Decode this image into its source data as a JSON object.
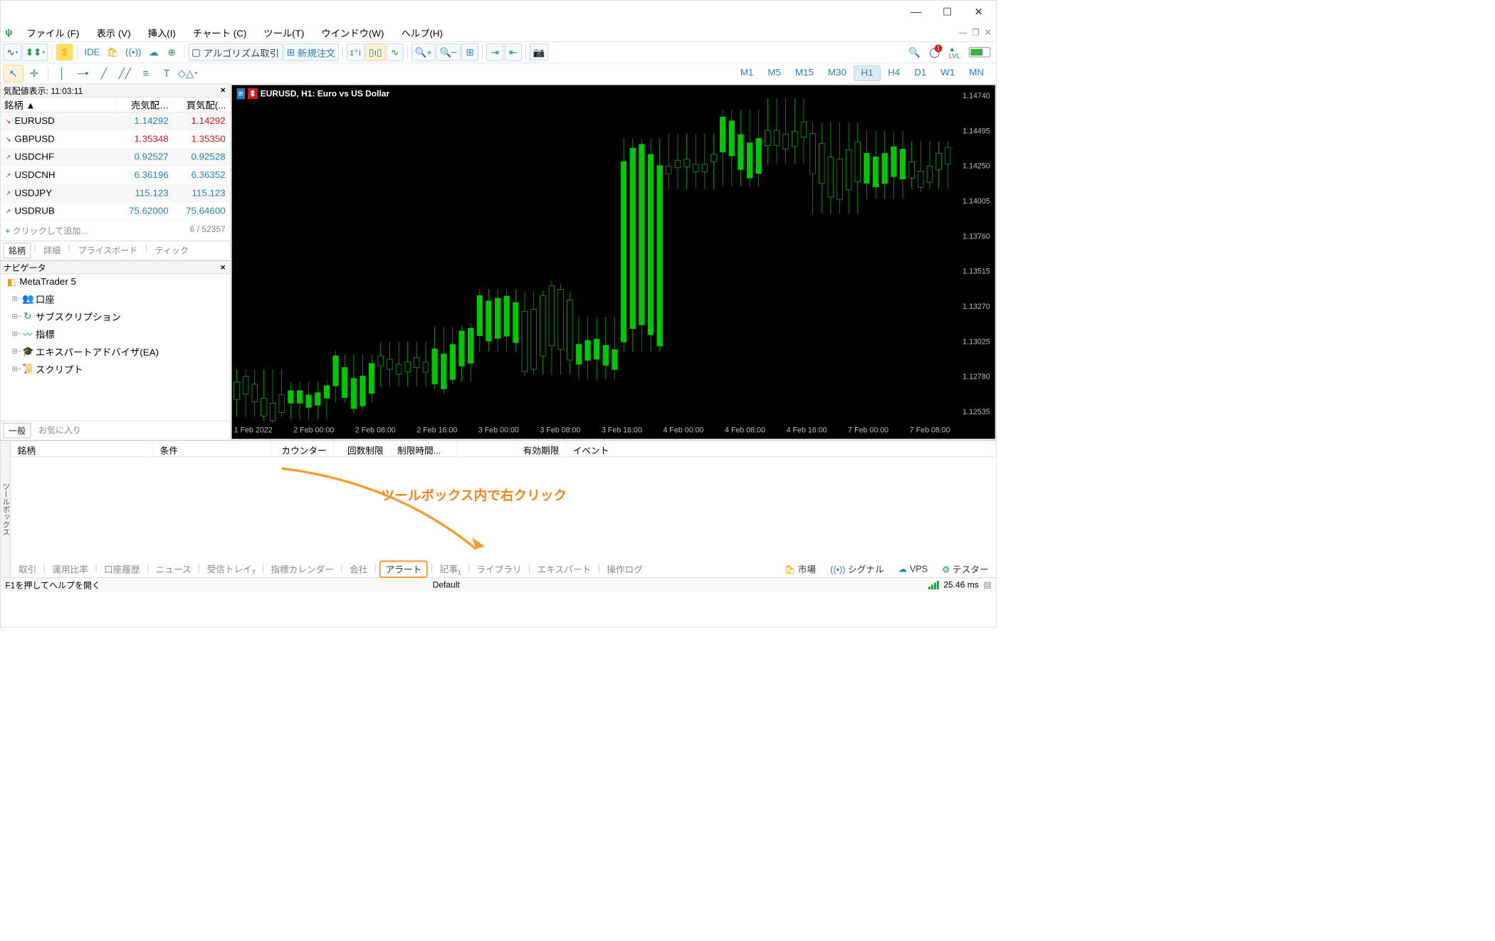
{
  "window": {
    "minimize": "—",
    "maximize": "☐",
    "close": "✕"
  },
  "menubar": {
    "logo": "ψ",
    "items": [
      "ファイル (F)",
      "表示 (V)",
      "挿入(I)",
      "チャート (C)",
      "ツール(T)",
      "ウインドウ(W)",
      "ヘルプ(H)"
    ]
  },
  "toolbar": {
    "algo": "アルゴリズム取引",
    "neworder": "新規注文",
    "notif_count": "1",
    "vps_label": "VPS"
  },
  "timeframes": [
    "M1",
    "M5",
    "M15",
    "M30",
    "H1",
    "H4",
    "D1",
    "W1",
    "MN"
  ],
  "timeframe_active": "H1",
  "market_watch": {
    "title": "気配値表示: 11:03:11",
    "cols": {
      "symbol": "銘柄  ▲",
      "bid": "売気配…",
      "ask": "買気配(..."
    },
    "rows": [
      {
        "dir": "down",
        "symbol": "EURUSD",
        "bid": "1.14292",
        "ask": "1.14292",
        "bidc": "blue",
        "askc": "red"
      },
      {
        "dir": "down",
        "symbol": "GBPUSD",
        "bid": "1.35348",
        "ask": "1.35350",
        "bidc": "red",
        "askc": "red"
      },
      {
        "dir": "up",
        "symbol": "USDCHF",
        "bid": "0.92527",
        "ask": "0.92528",
        "bidc": "blue",
        "askc": "blue"
      },
      {
        "dir": "up",
        "symbol": "USDCNH",
        "bid": "6.36196",
        "ask": "6.36352",
        "bidc": "blue",
        "askc": "blue"
      },
      {
        "dir": "up",
        "symbol": "USDJPY",
        "bid": "115.123",
        "ask": "115.123",
        "bidc": "blue",
        "askc": "blue"
      },
      {
        "dir": "up",
        "symbol": "USDRUB",
        "bid": "75.62000",
        "ask": "75.64600",
        "bidc": "blue",
        "askc": "blue"
      }
    ],
    "add_label": "クリックして追加...",
    "count": "6 / 52357",
    "tabs": [
      "銘柄",
      "詳細",
      "プライスボード",
      "ティック"
    ]
  },
  "navigator": {
    "title": "ナビゲータ",
    "root": "MetaTrader 5",
    "items": [
      {
        "icon": "👥",
        "color": "#2c7fb8",
        "label": "口座"
      },
      {
        "icon": "↻",
        "color": "#1a9641",
        "label": "サブスクリプション"
      },
      {
        "icon": "〰",
        "color": "#2c7fb8",
        "label": "指標"
      },
      {
        "icon": "🎓",
        "color": "#2c7fb8",
        "label": "エキスパートアドバイザ(EA)"
      },
      {
        "icon": "📜",
        "color": "#e6a500",
        "label": "スクリプト"
      }
    ],
    "tabs": [
      "一般",
      "お気に入り"
    ]
  },
  "chart": {
    "title": "EURUSD, H1:  Euro vs US Dollar",
    "yticks": [
      "1.14740",
      "1.14495",
      "1.14250",
      "1.14005",
      "1.13760",
      "1.13515",
      "1.13270",
      "1.13025",
      "1.12780",
      "1.12535"
    ],
    "xticks": [
      "1 Feb 2022",
      "2 Feb 00:00",
      "2 Feb 08:00",
      "2 Feb 16:00",
      "3 Feb 00:00",
      "3 Feb 08:00",
      "3 Feb 16:00",
      "4 Feb 00:00",
      "4 Feb 08:00",
      "4 Feb 16:00",
      "7 Feb 00:00",
      "7 Feb 08:00"
    ]
  },
  "chart_data": {
    "type": "candlestick",
    "symbol": "EURUSD",
    "timeframe": "H1",
    "ylim": [
      1.1229,
      1.14985
    ],
    "candles": [
      {
        "t": "2022-02-01 00:00",
        "o": 1.1256,
        "h": 1.1268,
        "l": 1.1238,
        "c": 1.1242
      },
      {
        "t": "2022-02-01 08:00",
        "o": 1.1242,
        "h": 1.1258,
        "l": 1.1236,
        "c": 1.1252
      },
      {
        "t": "2022-02-01 16:00",
        "o": 1.1252,
        "h": 1.128,
        "l": 1.125,
        "c": 1.1276
      },
      {
        "t": "2022-02-02 00:00",
        "o": 1.1276,
        "h": 1.129,
        "l": 1.1262,
        "c": 1.1268
      },
      {
        "t": "2022-02-02 08:00",
        "o": 1.1268,
        "h": 1.1302,
        "l": 1.1266,
        "c": 1.1296
      },
      {
        "t": "2022-02-02 16:00",
        "o": 1.1296,
        "h": 1.1332,
        "l": 1.129,
        "c": 1.1328
      },
      {
        "t": "2022-02-03 00:00",
        "o": 1.1328,
        "h": 1.133,
        "l": 1.1272,
        "c": 1.128
      },
      {
        "t": "2022-02-03 08:00",
        "o": 1.128,
        "h": 1.131,
        "l": 1.1268,
        "c": 1.1296
      },
      {
        "t": "2022-02-03 14:00",
        "o": 1.1296,
        "h": 1.1452,
        "l": 1.129,
        "c": 1.144
      },
      {
        "t": "2022-02-03 16:00",
        "o": 1.144,
        "h": 1.1456,
        "l": 1.142,
        "c": 1.1434
      },
      {
        "t": "2022-02-04 00:00",
        "o": 1.1434,
        "h": 1.1475,
        "l": 1.1422,
        "c": 1.1462
      },
      {
        "t": "2022-02-04 08:00",
        "o": 1.1462,
        "h": 1.1484,
        "l": 1.144,
        "c": 1.145
      },
      {
        "t": "2022-02-04 16:00",
        "o": 1.145,
        "h": 1.1465,
        "l": 1.14,
        "c": 1.1418
      },
      {
        "t": "2022-02-07 00:00",
        "o": 1.1418,
        "h": 1.1458,
        "l": 1.1412,
        "c": 1.1442
      },
      {
        "t": "2022-02-07 08:00",
        "o": 1.1442,
        "h": 1.145,
        "l": 1.142,
        "c": 1.1429
      }
    ]
  },
  "toolbox": {
    "vertical_label": "ツールボックス",
    "cols": [
      "銘柄",
      "条件",
      "カウンター",
      "回数制限",
      "制限時間...",
      "有効期限",
      "イベント"
    ],
    "tabs": [
      "取引",
      "運用比率",
      "口座履歴",
      "ニュース",
      "受信トレイ",
      "指標カレンダー",
      "会社",
      "アラート",
      "記事",
      "ライブラリ",
      "エキスパート",
      "操作ログ"
    ],
    "active_tab": "アラート",
    "inbox_badge": "7",
    "articles_badge": "1",
    "right": {
      "market": "市場",
      "signal": "シグナル",
      "vps": "VPS",
      "tester": "テスター"
    },
    "annotation": "ツールボックス内で右クリック"
  },
  "status": {
    "help": "F1を押してヘルプを開く",
    "profile": "Default",
    "ping": "25.46 ms"
  }
}
